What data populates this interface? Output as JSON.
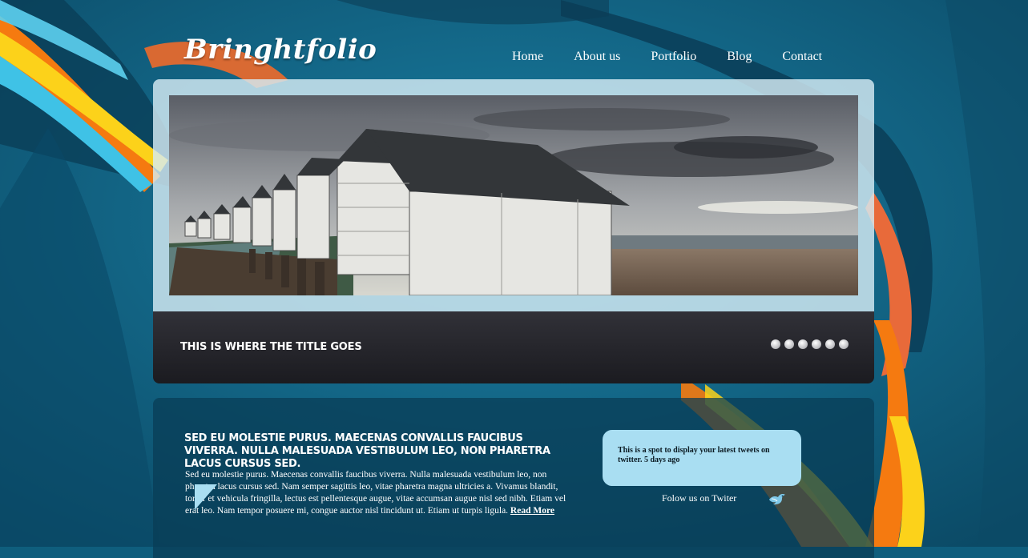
{
  "brand": {
    "logo_text": "Bringhtfolio"
  },
  "nav": {
    "items": [
      "Home",
      "About us",
      "Portfolio",
      "Blog",
      "Contact"
    ]
  },
  "slider": {
    "caption_title": "THIS IS WHERE THE TITLE GOES",
    "dot_count": 6
  },
  "content": {
    "heading": "SED EU MOLESTIE PURUS. MAECENAS CONVALLIS FAUCIBUS VIVERRA. NULLA MALESUADA VESTIBULUM LEO, NON PHARETRA LACUS CURSUS SED.",
    "body": "Sed eu molestie purus. Maecenas convallis faucibus viverra. Nulla malesuada vestibulum leo, non pharetra lacus cursus sed. Nam semper sagittis leo, vitae pharetra magna ultricies a. Vivamus blandit, tortor et vehicula fringilla, lectus est pellentesque augue, vitae accumsan augue nisl sed nibh. Etiam vel erat leo. Nam tempor posuere mi, congue auctor nisl tincidunt ut. Etiam ut turpis ligula.",
    "read_more": "Read More"
  },
  "twitter": {
    "tweet": "This is a spot to display your latest tweets on twitter. 5 days ago",
    "follow_label": "Folow us on Twiter",
    "icon": "twitter-bird-icon"
  },
  "colors": {
    "background": "#0f5e7d",
    "accent_orange": "#f57a10",
    "accent_yellow": "#fcd21a",
    "bubble": "#a9def2"
  }
}
